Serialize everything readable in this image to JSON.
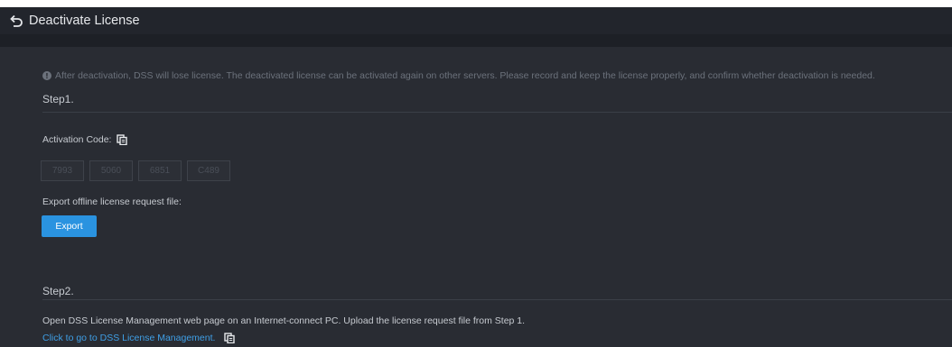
{
  "header": {
    "title": "Deactivate License"
  },
  "notice": "After deactivation, DSS will lose license. The deactivated license can be activated again on other servers. Please record and keep the license properly, and confirm whether deactivation is needed.",
  "step1": {
    "title": "Step1.",
    "activation_label": "Activation Code:",
    "codes": [
      "7993",
      "5060",
      "6851",
      "C489"
    ],
    "export_label": "Export offline license request file:",
    "export_button": "Export"
  },
  "step2": {
    "title": "Step2.",
    "instruction": "Open DSS License Management web page on an Internet-connect PC. Upload the license request file from Step 1.",
    "link": "Click to go to DSS License Management."
  },
  "colors": {
    "accent": "#2a93e0",
    "link": "#3f9fe6",
    "background": "#292c33"
  },
  "icons": [
    "back-arrow-icon",
    "info-icon",
    "copy-icon"
  ]
}
